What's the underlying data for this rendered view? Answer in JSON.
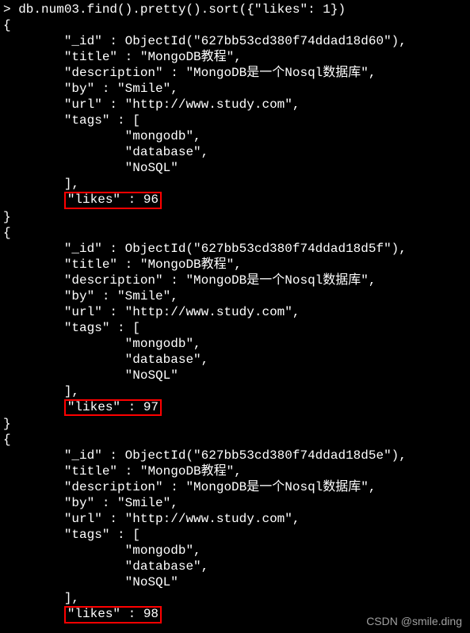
{
  "command": "db.num03.find().pretty().sort({\"likes\": 1})",
  "watermark": "CSDN @smile.ding",
  "docs": [
    {
      "id": "627bb53cd380f74ddad18d60",
      "title": "MongoDB教程",
      "description": "MongoDB是一个Nosql数据库",
      "by": "Smile",
      "url": "http://www.study.com",
      "tags": [
        "mongodb",
        "database",
        "NoSQL"
      ],
      "likes": 96
    },
    {
      "id": "627bb53cd380f74ddad18d5f",
      "title": "MongoDB教程",
      "description": "MongoDB是一个Nosql数据库",
      "by": "Smile",
      "url": "http://www.study.com",
      "tags": [
        "mongodb",
        "database",
        "NoSQL"
      ],
      "likes": 97
    },
    {
      "id": "627bb53cd380f74ddad18d5e",
      "title": "MongoDB教程",
      "description": "MongoDB是一个Nosql数据库",
      "by": "Smile",
      "url": "http://www.study.com",
      "tags": [
        "mongodb",
        "database",
        "NoSQL"
      ],
      "likes": 98
    }
  ]
}
